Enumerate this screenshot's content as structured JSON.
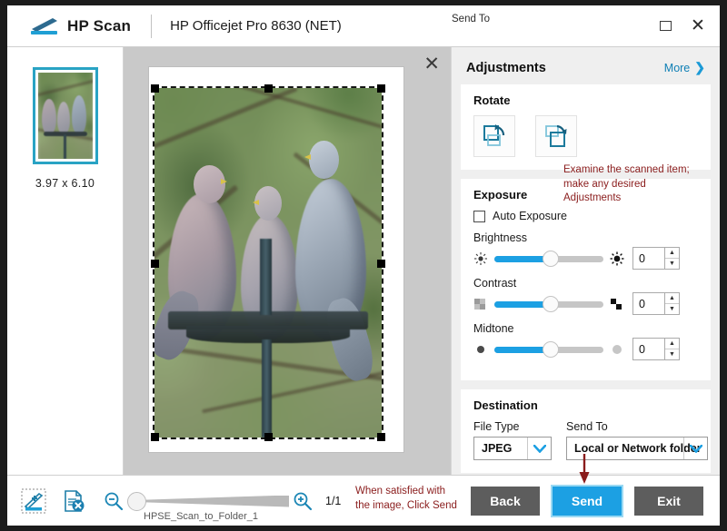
{
  "window": {
    "app_name": "HP Scan",
    "device_name": "HP Officejet Pro 8630 (NET)",
    "send_to_hint": "Send To",
    "minimize_label": "Minimize",
    "close_label": "Close",
    "logo_icon": "scanner-icon"
  },
  "thumbnails": {
    "size_label": "3.97  x  6.10",
    "selected_border_color": "#29a3c4"
  },
  "preview": {
    "close_label": "✕",
    "image_description": "three band-tailed pigeons perched on a metal bird feeder"
  },
  "adjustments": {
    "title": "Adjustments",
    "more_label": "More",
    "more_chevron": "❯",
    "rotate": {
      "title": "Rotate",
      "left_icon": "rotate-left-icon",
      "right_icon": "rotate-right-icon"
    },
    "exposure": {
      "title": "Exposure",
      "auto_label": "Auto Exposure",
      "auto_checked": false,
      "sliders": [
        {
          "label": "Brightness",
          "value": "0",
          "left_icon": "brightness-low-icon",
          "right_icon": "brightness-high-icon",
          "fill_percent": 52
        },
        {
          "label": "Contrast",
          "value": "0",
          "left_icon": "contrast-low-icon",
          "right_icon": "contrast-high-icon",
          "fill_percent": 52
        },
        {
          "label": "Midtone",
          "value": "0",
          "left_icon": "midtone-dark-icon",
          "right_icon": "midtone-light-icon",
          "fill_percent": 52
        }
      ],
      "spin_up": "▲",
      "spin_down": "▼"
    },
    "destination": {
      "title": "Destination",
      "file_type_label": "File Type",
      "file_type_value": "JPEG",
      "send_to_label": "Send To",
      "send_to_value": "Local or Network folder",
      "chevron": "⌵"
    }
  },
  "annotations": {
    "examine": "Examine the scanned item; make any desired Adjustments",
    "send": "When satisfied with the image, Click Send",
    "color": "#8a1c1c"
  },
  "bottom_bar": {
    "add_scan_icon": "add-scan-icon",
    "delete_page_icon": "delete-page-icon",
    "zoom_out_icon": "zoom-out-icon",
    "zoom_in_icon": "zoom-in-icon",
    "zoom_filename": "HPSE_Scan_to_Folder_1",
    "page_count": "1/1",
    "buttons": {
      "back": "Back",
      "send": "Send",
      "exit": "Exit"
    },
    "accent_color": "#1ca0e3"
  }
}
